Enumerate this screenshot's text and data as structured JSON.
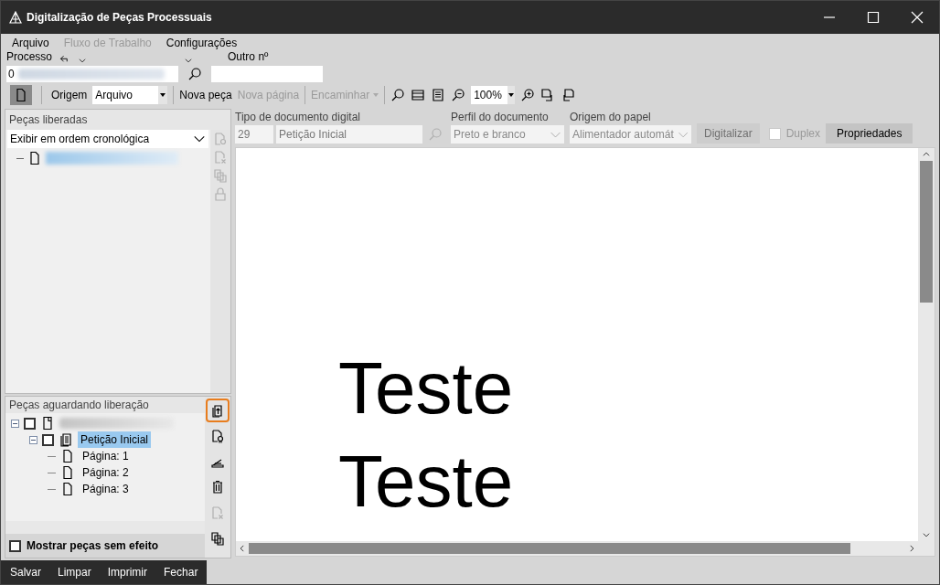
{
  "window": {
    "title": "Digitalização de Peças Processuais"
  },
  "menu": [
    {
      "label": "Arquivo",
      "disabled": false
    },
    {
      "label": "Fluxo de Trabalho",
      "disabled": true
    },
    {
      "label": "Configurações",
      "disabled": false
    }
  ],
  "process": {
    "label": "Processo",
    "value": "0",
    "other_label": "Outro nº"
  },
  "toolbar": {
    "origin_label": "Origem",
    "origin_value": "Arquivo",
    "zoom": "100%",
    "buttons": [
      {
        "label": "Nova peça",
        "disabled": false
      },
      {
        "label": "Nova página",
        "disabled": true
      },
      {
        "label": "Encaminhar",
        "disabled": true
      }
    ]
  },
  "released": {
    "title": "Peças liberadas",
    "order": "Exibir em ordem cronológica"
  },
  "pending": {
    "title": "Peças aguardando liberação",
    "tools": [
      {
        "kind": "upload",
        "disabled": false,
        "highlighted": true
      },
      {
        "kind": "certificate",
        "disabled": false,
        "highlighted": false
      },
      {
        "kind": "scanner",
        "disabled": false,
        "highlighted": false
      },
      {
        "kind": "trash",
        "disabled": false,
        "highlighted": false
      },
      {
        "kind": "delete",
        "disabled": true,
        "highlighted": false
      },
      {
        "kind": "copy",
        "disabled": false,
        "highlighted": false
      }
    ],
    "tree": [
      {
        "kind": "part",
        "checked": false,
        "expanded": true,
        "selected": false,
        "children": [
          {
            "kind": "document",
            "label": "Petição Inicial",
            "checked": false,
            "expanded": true,
            "selected": true,
            "children": [
              {
                "kind": "page",
                "label": "Página: 1",
                "selected": false
              },
              {
                "kind": "page",
                "label": "Página: 2",
                "selected": false
              },
              {
                "kind": "page",
                "label": "Página: 3",
                "selected": false
              }
            ]
          }
        ]
      }
    ]
  },
  "show_void": {
    "label": "Mostrar peças sem efeito",
    "checked": false
  },
  "footer_buttons": [
    "Salvar",
    "Limpar",
    "Imprimir",
    "Fechar"
  ],
  "doc_form": {
    "type_label": "Tipo de documento digital",
    "type_code": "29",
    "type_value": "Petição Inicial",
    "profile_label": "Perfil do documento",
    "profile_value": "Preto e branco",
    "paper_label": "Origem do papel",
    "paper_value": "Alimentador automát",
    "scan_button": "Digitalizar",
    "scan_disabled": true,
    "duplex": {
      "label": "Duplex",
      "checked": false
    },
    "properties_button": "Propriedades"
  },
  "document": {
    "lines": [
      "Teste",
      "Teste"
    ]
  }
}
